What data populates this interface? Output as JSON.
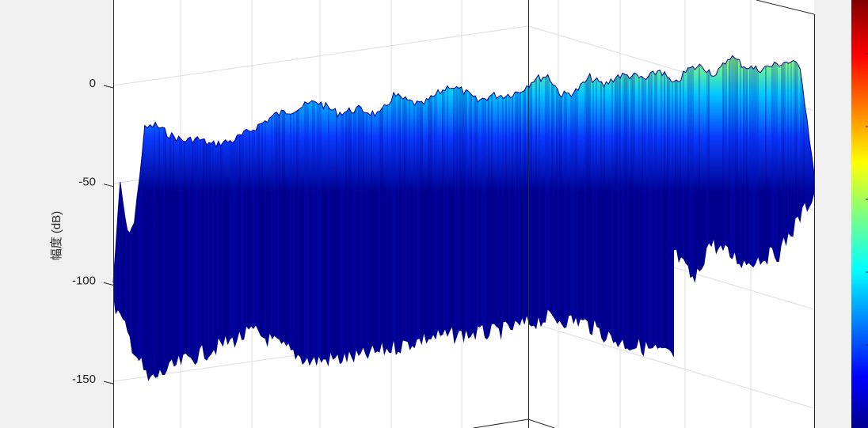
{
  "chart_data": {
    "type": "area",
    "title": "",
    "xlabel": "",
    "ylabel": "幅度 (dB)",
    "zlim": [
      -170,
      40
    ],
    "z_ticks": [
      0,
      -50,
      -100,
      -150
    ],
    "grid": true,
    "colormap": "jet",
    "colorbar": "right",
    "colors": {
      "figure_bg": "#f0f0f0",
      "axes_bg": "#ffffff",
      "axis_line": "#262626",
      "grid": "#d9d9d9",
      "surface_base": "#00008f"
    },
    "series": [
      {
        "role": "amplitude-envelope",
        "x": [
          0.0,
          0.01,
          0.02,
          0.03,
          0.045,
          0.06,
          0.08,
          0.1,
          0.12,
          0.14,
          0.17,
          0.2,
          0.23,
          0.26,
          0.29,
          0.32,
          0.35,
          0.38,
          0.4,
          0.42,
          0.44,
          0.46,
          0.48,
          0.5,
          0.52,
          0.54,
          0.56,
          0.58,
          0.6,
          0.62,
          0.64,
          0.66,
          0.68,
          0.7,
          0.72,
          0.74,
          0.76,
          0.78,
          0.8,
          0.82,
          0.84,
          0.86,
          0.88,
          0.9,
          0.92,
          0.94,
          0.96,
          0.98,
          1.0
        ],
        "y": [
          -100,
          -50,
          -75,
          -70,
          -22,
          -20,
          -25,
          -28,
          -27,
          -30,
          -28,
          -22,
          -15,
          -12,
          -8,
          -14,
          -12,
          -15,
          -5,
          -8,
          -10,
          -5,
          0,
          -3,
          -8,
          -5,
          -5,
          -3,
          3,
          5,
          -5,
          -3,
          4,
          0,
          5,
          5,
          3,
          8,
          0,
          8,
          10,
          5,
          15,
          10,
          8,
          10,
          12,
          10,
          -45
        ]
      }
    ]
  }
}
